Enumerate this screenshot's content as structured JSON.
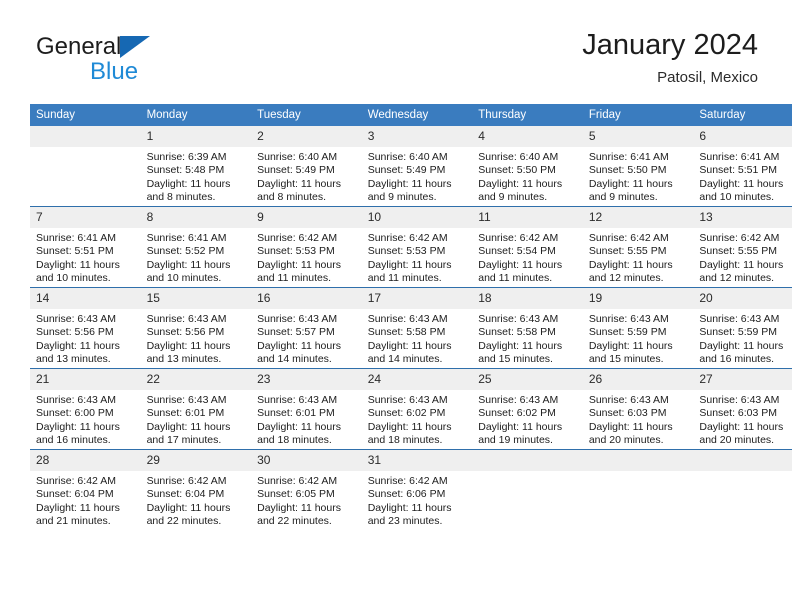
{
  "brand": {
    "name_part1": "General",
    "name_part2": "Blue",
    "logo_icon": "blue-triangle-flag-icon"
  },
  "header": {
    "title": "January 2024",
    "subtitle": "Patosil, Mexico"
  },
  "colors": {
    "header_blue": "#3a7cbf",
    "row_divider_blue": "#2f6fab",
    "daynum_band": "#efefef",
    "brand_blue": "#1f8ad6",
    "logo_blue": "#1668b3"
  },
  "calendar": {
    "weekday_headers": [
      "Sunday",
      "Monday",
      "Tuesday",
      "Wednesday",
      "Thursday",
      "Friday",
      "Saturday"
    ],
    "weeks": [
      [
        {
          "day": "",
          "sunrise": "",
          "sunset": "",
          "daylight_line1": "",
          "daylight_line2": "",
          "empty": true
        },
        {
          "day": "1",
          "sunrise": "Sunrise: 6:39 AM",
          "sunset": "Sunset: 5:48 PM",
          "daylight_line1": "Daylight: 11 hours",
          "daylight_line2": "and 8 minutes."
        },
        {
          "day": "2",
          "sunrise": "Sunrise: 6:40 AM",
          "sunset": "Sunset: 5:49 PM",
          "daylight_line1": "Daylight: 11 hours",
          "daylight_line2": "and 8 minutes."
        },
        {
          "day": "3",
          "sunrise": "Sunrise: 6:40 AM",
          "sunset": "Sunset: 5:49 PM",
          "daylight_line1": "Daylight: 11 hours",
          "daylight_line2": "and 9 minutes."
        },
        {
          "day": "4",
          "sunrise": "Sunrise: 6:40 AM",
          "sunset": "Sunset: 5:50 PM",
          "daylight_line1": "Daylight: 11 hours",
          "daylight_line2": "and 9 minutes."
        },
        {
          "day": "5",
          "sunrise": "Sunrise: 6:41 AM",
          "sunset": "Sunset: 5:50 PM",
          "daylight_line1": "Daylight: 11 hours",
          "daylight_line2": "and 9 minutes."
        },
        {
          "day": "6",
          "sunrise": "Sunrise: 6:41 AM",
          "sunset": "Sunset: 5:51 PM",
          "daylight_line1": "Daylight: 11 hours",
          "daylight_line2": "and 10 minutes."
        }
      ],
      [
        {
          "day": "7",
          "sunrise": "Sunrise: 6:41 AM",
          "sunset": "Sunset: 5:51 PM",
          "daylight_line1": "Daylight: 11 hours",
          "daylight_line2": "and 10 minutes."
        },
        {
          "day": "8",
          "sunrise": "Sunrise: 6:41 AM",
          "sunset": "Sunset: 5:52 PM",
          "daylight_line1": "Daylight: 11 hours",
          "daylight_line2": "and 10 minutes."
        },
        {
          "day": "9",
          "sunrise": "Sunrise: 6:42 AM",
          "sunset": "Sunset: 5:53 PM",
          "daylight_line1": "Daylight: 11 hours",
          "daylight_line2": "and 11 minutes."
        },
        {
          "day": "10",
          "sunrise": "Sunrise: 6:42 AM",
          "sunset": "Sunset: 5:53 PM",
          "daylight_line1": "Daylight: 11 hours",
          "daylight_line2": "and 11 minutes."
        },
        {
          "day": "11",
          "sunrise": "Sunrise: 6:42 AM",
          "sunset": "Sunset: 5:54 PM",
          "daylight_line1": "Daylight: 11 hours",
          "daylight_line2": "and 11 minutes."
        },
        {
          "day": "12",
          "sunrise": "Sunrise: 6:42 AM",
          "sunset": "Sunset: 5:55 PM",
          "daylight_line1": "Daylight: 11 hours",
          "daylight_line2": "and 12 minutes."
        },
        {
          "day": "13",
          "sunrise": "Sunrise: 6:42 AM",
          "sunset": "Sunset: 5:55 PM",
          "daylight_line1": "Daylight: 11 hours",
          "daylight_line2": "and 12 minutes."
        }
      ],
      [
        {
          "day": "14",
          "sunrise": "Sunrise: 6:43 AM",
          "sunset": "Sunset: 5:56 PM",
          "daylight_line1": "Daylight: 11 hours",
          "daylight_line2": "and 13 minutes."
        },
        {
          "day": "15",
          "sunrise": "Sunrise: 6:43 AM",
          "sunset": "Sunset: 5:56 PM",
          "daylight_line1": "Daylight: 11 hours",
          "daylight_line2": "and 13 minutes."
        },
        {
          "day": "16",
          "sunrise": "Sunrise: 6:43 AM",
          "sunset": "Sunset: 5:57 PM",
          "daylight_line1": "Daylight: 11 hours",
          "daylight_line2": "and 14 minutes."
        },
        {
          "day": "17",
          "sunrise": "Sunrise: 6:43 AM",
          "sunset": "Sunset: 5:58 PM",
          "daylight_line1": "Daylight: 11 hours",
          "daylight_line2": "and 14 minutes."
        },
        {
          "day": "18",
          "sunrise": "Sunrise: 6:43 AM",
          "sunset": "Sunset: 5:58 PM",
          "daylight_line1": "Daylight: 11 hours",
          "daylight_line2": "and 15 minutes."
        },
        {
          "day": "19",
          "sunrise": "Sunrise: 6:43 AM",
          "sunset": "Sunset: 5:59 PM",
          "daylight_line1": "Daylight: 11 hours",
          "daylight_line2": "and 15 minutes."
        },
        {
          "day": "20",
          "sunrise": "Sunrise: 6:43 AM",
          "sunset": "Sunset: 5:59 PM",
          "daylight_line1": "Daylight: 11 hours",
          "daylight_line2": "and 16 minutes."
        }
      ],
      [
        {
          "day": "21",
          "sunrise": "Sunrise: 6:43 AM",
          "sunset": "Sunset: 6:00 PM",
          "daylight_line1": "Daylight: 11 hours",
          "daylight_line2": "and 16 minutes."
        },
        {
          "day": "22",
          "sunrise": "Sunrise: 6:43 AM",
          "sunset": "Sunset: 6:01 PM",
          "daylight_line1": "Daylight: 11 hours",
          "daylight_line2": "and 17 minutes."
        },
        {
          "day": "23",
          "sunrise": "Sunrise: 6:43 AM",
          "sunset": "Sunset: 6:01 PM",
          "daylight_line1": "Daylight: 11 hours",
          "daylight_line2": "and 18 minutes."
        },
        {
          "day": "24",
          "sunrise": "Sunrise: 6:43 AM",
          "sunset": "Sunset: 6:02 PM",
          "daylight_line1": "Daylight: 11 hours",
          "daylight_line2": "and 18 minutes."
        },
        {
          "day": "25",
          "sunrise": "Sunrise: 6:43 AM",
          "sunset": "Sunset: 6:02 PM",
          "daylight_line1": "Daylight: 11 hours",
          "daylight_line2": "and 19 minutes."
        },
        {
          "day": "26",
          "sunrise": "Sunrise: 6:43 AM",
          "sunset": "Sunset: 6:03 PM",
          "daylight_line1": "Daylight: 11 hours",
          "daylight_line2": "and 20 minutes."
        },
        {
          "day": "27",
          "sunrise": "Sunrise: 6:43 AM",
          "sunset": "Sunset: 6:03 PM",
          "daylight_line1": "Daylight: 11 hours",
          "daylight_line2": "and 20 minutes."
        }
      ],
      [
        {
          "day": "28",
          "sunrise": "Sunrise: 6:42 AM",
          "sunset": "Sunset: 6:04 PM",
          "daylight_line1": "Daylight: 11 hours",
          "daylight_line2": "and 21 minutes."
        },
        {
          "day": "29",
          "sunrise": "Sunrise: 6:42 AM",
          "sunset": "Sunset: 6:04 PM",
          "daylight_line1": "Daylight: 11 hours",
          "daylight_line2": "and 22 minutes."
        },
        {
          "day": "30",
          "sunrise": "Sunrise: 6:42 AM",
          "sunset": "Sunset: 6:05 PM",
          "daylight_line1": "Daylight: 11 hours",
          "daylight_line2": "and 22 minutes."
        },
        {
          "day": "31",
          "sunrise": "Sunrise: 6:42 AM",
          "sunset": "Sunset: 6:06 PM",
          "daylight_line1": "Daylight: 11 hours",
          "daylight_line2": "and 23 minutes."
        },
        {
          "day": "",
          "sunrise": "",
          "sunset": "",
          "daylight_line1": "",
          "daylight_line2": "",
          "empty": true
        },
        {
          "day": "",
          "sunrise": "",
          "sunset": "",
          "daylight_line1": "",
          "daylight_line2": "",
          "empty": true
        },
        {
          "day": "",
          "sunrise": "",
          "sunset": "",
          "daylight_line1": "",
          "daylight_line2": "",
          "empty": true
        }
      ]
    ]
  }
}
